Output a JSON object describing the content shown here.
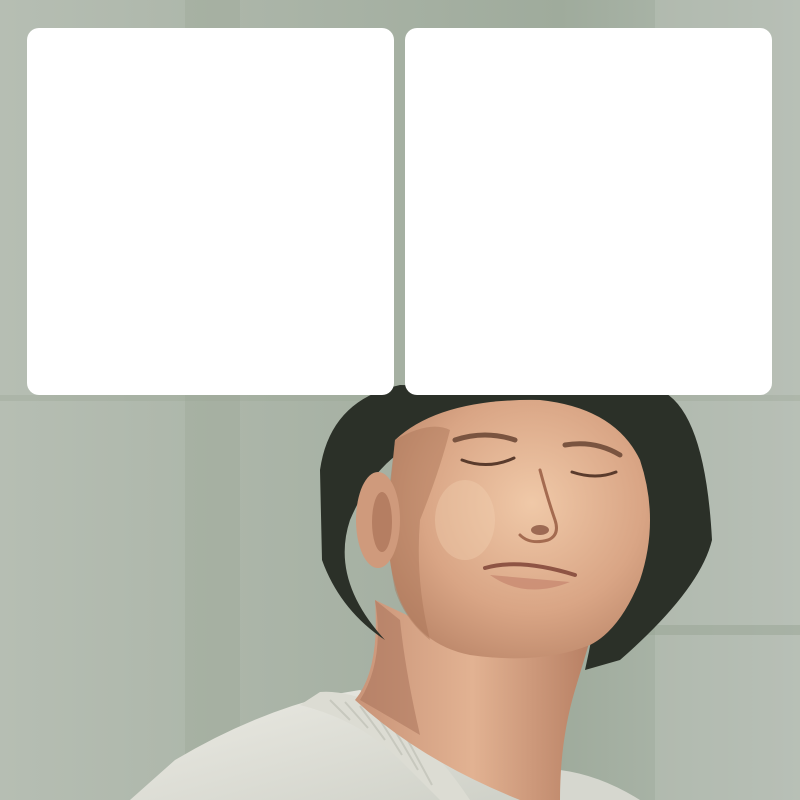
{
  "scene": {
    "subject": "person-bucket-hat-eyes-closed",
    "background_color": "#aab5a8",
    "skin_tone": "#d8a98c",
    "hat_color": "#2b3028",
    "sweater_color": "#e6e4dc"
  },
  "panels": [
    {
      "fill": "#ffffff",
      "content": ""
    },
    {
      "fill": "#ffffff",
      "content": ""
    }
  ]
}
